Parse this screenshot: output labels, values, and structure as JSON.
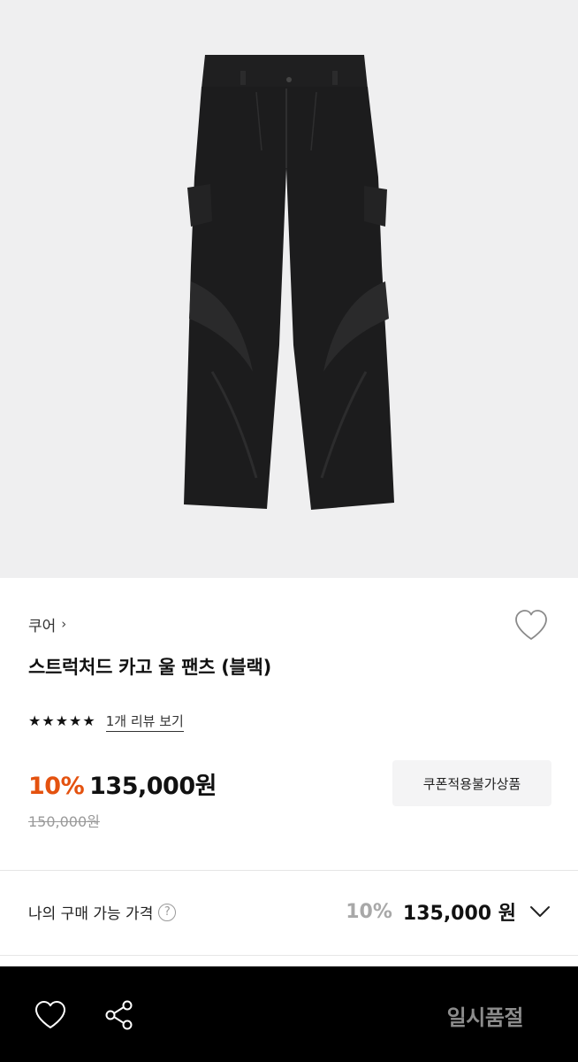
{
  "product_image": {
    "alt": "",
    "background": "#efeff0"
  },
  "brand": {
    "name": "쿠어",
    "chevron": "›"
  },
  "wish_icon": "heart-outline-icon",
  "title": "스트럭처드 카고 울 팬츠 (블랙)",
  "rating": {
    "stars": 5,
    "star_glyph": "★",
    "review_link": "1개 리뷰 보기"
  },
  "price": {
    "discount": "10%",
    "sale_price": "135,000원",
    "original_price": "150,000원"
  },
  "coupon_button": "쿠폰적용불가상품",
  "my_price": {
    "label": "나의 구매 가능 가격",
    "help_glyph": "?",
    "discount": "10%",
    "price": "135,000 원"
  },
  "bottom_bar": {
    "heart_icon": "heart-icon",
    "share_icon": "share-icon",
    "status": "일시품절"
  },
  "colors": {
    "accent": "#e4520f",
    "bar": "#000000",
    "muted": "#8c8c8c"
  }
}
